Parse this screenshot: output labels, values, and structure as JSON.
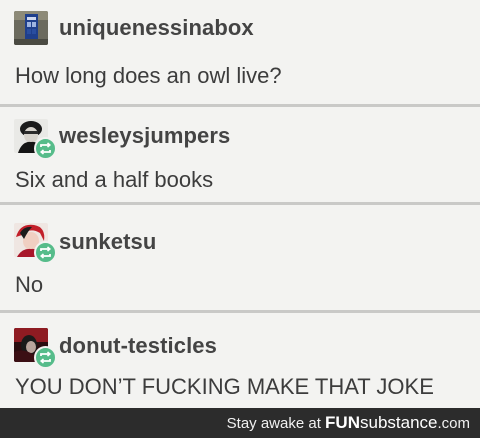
{
  "posts": [
    {
      "username": "uniquenessinabox",
      "text": "How long does an owl live?",
      "avatar_icon": "tardis-avatar",
      "reblog": false
    },
    {
      "username": "wesleysjumpers",
      "text": "Six and a half books",
      "avatar_icon": "dark-portrait-avatar",
      "reblog": true
    },
    {
      "username": "sunketsu",
      "text": "No",
      "avatar_icon": "red-portrait-avatar",
      "reblog": true
    },
    {
      "username": "donut-testicles",
      "text": "YOU DON’T FUCKING MAKE THAT JOKE",
      "avatar_icon": "red-dark-portrait-avatar",
      "reblog": true
    }
  ],
  "footer": {
    "prefix": "Stay awake at ",
    "brand_fun": "FUN",
    "brand_sub": "substance",
    "suffix": ".com"
  },
  "colors": {
    "background": "#f3f3f1",
    "divider": "#c9c9c7",
    "reblog_badge": "#56bc8a",
    "footer_bar": "#2c2c2c"
  }
}
